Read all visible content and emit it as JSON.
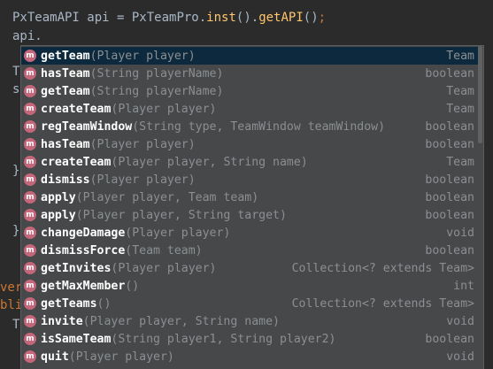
{
  "code": {
    "line1": {
      "class_name": "PxTeamAPI",
      "var_decl": " api = ",
      "target": "PxTeamPro",
      "dot1": ".",
      "method1": "inst",
      "call1": "().",
      "method2": "getAPI",
      "call2": "()",
      "semicolon": ";"
    },
    "line2": "api."
  },
  "gutter": {
    "fragments": [
      "T",
      "s",
      "",
      "",
      "}",
      "",
      "",
      "}",
      "",
      "",
      "",
      "ver",
      "bli",
      "T",
      ""
    ]
  },
  "completion": {
    "icon_letter": "m",
    "icon_color": "#c5677b",
    "selected_bg": "#0d293e",
    "items": [
      {
        "name": "getTeam",
        "params": "(Player player)",
        "type": "Team"
      },
      {
        "name": "hasTeam",
        "params": "(String playerName)",
        "type": "boolean"
      },
      {
        "name": "getTeam",
        "params": "(String playerName)",
        "type": "Team"
      },
      {
        "name": "createTeam",
        "params": "(Player player)",
        "type": "Team"
      },
      {
        "name": "regTeamWindow",
        "params": "(String type, TeamWindow teamWindow)",
        "type": "boolean"
      },
      {
        "name": "hasTeam",
        "params": "(Player player)",
        "type": "boolean"
      },
      {
        "name": "createTeam",
        "params": "(Player player, String name)",
        "type": "Team"
      },
      {
        "name": "dismiss",
        "params": "(Player player)",
        "type": "boolean"
      },
      {
        "name": "apply",
        "params": "(Player player, Team team)",
        "type": "boolean"
      },
      {
        "name": "apply",
        "params": "(Player player, String target)",
        "type": "boolean"
      },
      {
        "name": "changeDamage",
        "params": "(Player player)",
        "type": "void"
      },
      {
        "name": "dismissForce",
        "params": "(Team team)",
        "type": "boolean"
      },
      {
        "name": "getInvites",
        "params": "(Player player)",
        "type": "Collection<? extends Team>"
      },
      {
        "name": "getMaxMember",
        "params": "()",
        "type": "int"
      },
      {
        "name": "getTeams",
        "params": "()",
        "type": "Collection<? extends Team>"
      },
      {
        "name": "invite",
        "params": "(Player player, String name)",
        "type": "void"
      },
      {
        "name": "isSameTeam",
        "params": "(String player1, String player2)",
        "type": "boolean"
      },
      {
        "name": "quit",
        "params": "(Player player)",
        "type": "void"
      }
    ]
  }
}
